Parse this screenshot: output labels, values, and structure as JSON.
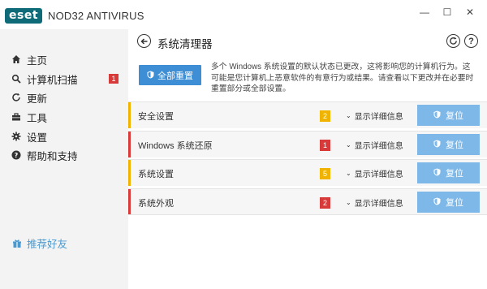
{
  "app": {
    "logo_text": "eset",
    "product_name": "NOD32 ANTIVIRUS"
  },
  "window_controls": {
    "minimize": "—",
    "maximize": "☐",
    "close": "✕"
  },
  "sidebar": {
    "items": [
      {
        "label": "主页",
        "icon": "home-icon"
      },
      {
        "label": "计算机扫描",
        "icon": "search-icon",
        "badge": "1"
      },
      {
        "label": "更新",
        "icon": "refresh-icon"
      },
      {
        "label": "工具",
        "icon": "toolbox-icon"
      },
      {
        "label": "设置",
        "icon": "gear-icon"
      },
      {
        "label": "帮助和支持",
        "icon": "help-icon"
      }
    ],
    "recommend_label": "推荐好友"
  },
  "header": {
    "title": "系统清理器"
  },
  "reset_all_label": "全部重置",
  "description": "多个 Windows 系统设置的默认状态已更改，这将影响您的计算机行为。这可能是您计算机上恶意软件的有意行为或结果。请查看以下更改并在必要时重置部分或全部设置。",
  "categories": [
    {
      "name": "安全设置",
      "count": "2",
      "color": "#f0b400",
      "details_label": "显示详细信息",
      "reset_label": "复位"
    },
    {
      "name": "Windows 系统还原",
      "count": "1",
      "color": "#d83a3a",
      "details_label": "显示详细信息",
      "reset_label": "复位"
    },
    {
      "name": "系统设置",
      "count": "5",
      "color": "#f0b400",
      "details_label": "显示详细信息",
      "reset_label": "复位"
    },
    {
      "name": "系统外观",
      "count": "2",
      "color": "#d83a3a",
      "details_label": "显示详细信息",
      "reset_label": "复位"
    }
  ],
  "colors": {
    "accent": "#3d8ed4",
    "button_light": "#7eb8e8",
    "warning": "#f0b400",
    "danger": "#d83a3a",
    "link": "#4a9ad0"
  }
}
